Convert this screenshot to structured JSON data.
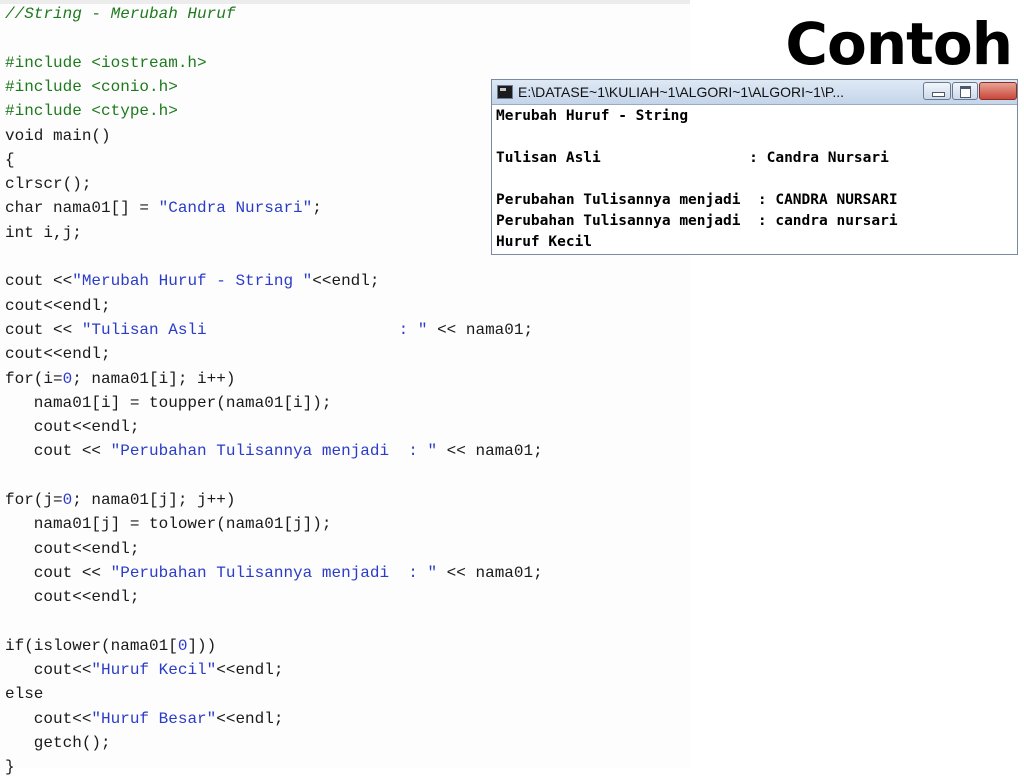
{
  "slide": {
    "title": "Contoh"
  },
  "code": {
    "lines": [
      [
        {
          "t": "//String - Merubah Huruf",
          "c": "comment"
        }
      ],
      [],
      [
        {
          "t": "#include <iostream.h>",
          "c": "pp"
        }
      ],
      [
        {
          "t": "#include <conio.h>",
          "c": "pp"
        }
      ],
      [
        {
          "t": "#include <ctype.h>",
          "c": "pp"
        }
      ],
      [
        {
          "t": "void main()"
        }
      ],
      [
        {
          "t": "{"
        }
      ],
      [
        {
          "t": "clrscr();"
        }
      ],
      [
        {
          "t": "char nama01[] = "
        },
        {
          "t": "\"Candra Nursari\"",
          "c": "str"
        },
        {
          "t": ";"
        }
      ],
      [
        {
          "t": "int i,j;"
        }
      ],
      [],
      [
        {
          "t": "cout <<"
        },
        {
          "t": "\"Merubah Huruf - String \"",
          "c": "str"
        },
        {
          "t": "<<endl;"
        }
      ],
      [
        {
          "t": "cout<<endl;"
        }
      ],
      [
        {
          "t": "cout << "
        },
        {
          "t": "\"Tulisan Asli                    : \"",
          "c": "str"
        },
        {
          "t": " << nama01;"
        }
      ],
      [
        {
          "t": "cout<<endl;"
        }
      ],
      [
        {
          "t": "for(i="
        },
        {
          "t": "0",
          "c": "num"
        },
        {
          "t": "; nama01[i]; i++)"
        }
      ],
      [
        {
          "t": "   nama01[i] = toupper(nama01[i]);"
        }
      ],
      [
        {
          "t": "   cout<<endl;"
        }
      ],
      [
        {
          "t": "   cout << "
        },
        {
          "t": "\"Perubahan Tulisannya menjadi  : \"",
          "c": "str"
        },
        {
          "t": " << nama01;"
        }
      ],
      [],
      [
        {
          "t": "for(j="
        },
        {
          "t": "0",
          "c": "num"
        },
        {
          "t": "; nama01[j]; j++)"
        }
      ],
      [
        {
          "t": "   nama01[j] = tolower(nama01[j]);"
        }
      ],
      [
        {
          "t": "   cout<<endl;"
        }
      ],
      [
        {
          "t": "   cout << "
        },
        {
          "t": "\"Perubahan Tulisannya menjadi  : \"",
          "c": "str"
        },
        {
          "t": " << nama01;"
        }
      ],
      [
        {
          "t": "   cout<<endl;"
        }
      ],
      [],
      [
        {
          "t": "if(islower(nama01["
        },
        {
          "t": "0",
          "c": "num"
        },
        {
          "t": "]))"
        }
      ],
      [
        {
          "t": "   cout<<"
        },
        {
          "t": "\"Huruf Kecil\"",
          "c": "str"
        },
        {
          "t": "<<endl;"
        }
      ],
      [
        {
          "t": "else"
        }
      ],
      [
        {
          "t": "   cout<<"
        },
        {
          "t": "\"Huruf Besar\"",
          "c": "str"
        },
        {
          "t": "<<endl;"
        }
      ],
      [
        {
          "t": "   getch();"
        }
      ],
      [
        {
          "t": "}"
        }
      ]
    ]
  },
  "console": {
    "title": "E:\\DATASE~1\\KULIAH~1\\ALGORI~1\\ALGORI~1\\P...",
    "icon": "console-app-icon",
    "buttons": {
      "minimize": "minimize-icon",
      "maximize": "maximize-icon",
      "close": "close-icon"
    },
    "lines": [
      "Merubah Huruf - String",
      "",
      "Tulisan Asli                 : Candra Nursari",
      "",
      "Perubahan Tulisannya menjadi  : CANDRA NURSARI",
      "Perubahan Tulisannya menjadi  : candra nursari",
      "Huruf Kecil"
    ]
  },
  "colors": {
    "comment": "#1e7a1e",
    "string": "#2a3cc8",
    "close_button": "#c9473b"
  }
}
